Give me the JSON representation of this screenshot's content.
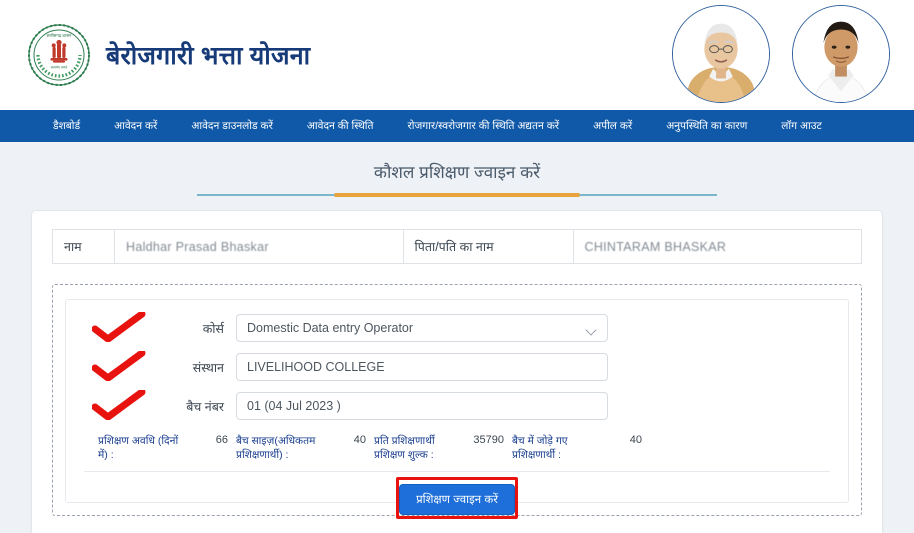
{
  "header": {
    "brand_title": "बेरोजगारी भत्ता योजना",
    "emblem_name": "chhattisgarh-government-emblem",
    "portrait_left_name": "chief-minister-portrait",
    "portrait_right_name": "minister-portrait"
  },
  "nav": {
    "items": [
      {
        "label": "डैशबोर्ड"
      },
      {
        "label": "आवेदन करें"
      },
      {
        "label": "आवेदन डाउनलोड करें"
      },
      {
        "label": "आवेदन की स्थिति"
      },
      {
        "label": "रोजगार/स्वरोजगार की स्थिति अद्यतन करें"
      },
      {
        "label": "अपील करें"
      },
      {
        "label": "अनुपस्थिति का कारण"
      },
      {
        "label": "लॉग आउट"
      }
    ]
  },
  "page": {
    "title": "कौशल प्रशिक्षण ज्वाइन करें"
  },
  "applicant": {
    "name_label": "नाम",
    "name_value": "Haldhar Prasad Bhaskar",
    "father_label": "पिता/पति का नाम",
    "father_value": "CHINTARAM BHASKAR"
  },
  "form": {
    "course_label": "कोर्स",
    "course_value": "Domestic Data entry Operator",
    "institute_label": "संस्थान",
    "institute_value": "LIVELIHOOD COLLEGE",
    "batch_label": "बैच नंबर",
    "batch_value": "01 (04 Jul 2023 )"
  },
  "stats": [
    {
      "label": "प्रशिक्षण अवधि (दिनों में) :",
      "value": "66"
    },
    {
      "label": "बैच साइज़(अधिकतम प्रशिक्षणार्थी) :",
      "value": "40"
    },
    {
      "label": "प्रति प्रशिक्षणार्थी प्रशिक्षण शुल्क :",
      "value": "35790"
    },
    {
      "label": "बैच में जोड़े गए प्रशिक्षणार्थी :",
      "value": "40"
    }
  ],
  "action": {
    "join_label": "प्रशिक्षण ज्वाइन करें"
  },
  "colors": {
    "nav_blue": "#1059a8",
    "brand_navy": "#173a78",
    "accent_orange": "#e8a33d",
    "rule_teal": "#7ab7c9",
    "button_blue": "#1e6fd9",
    "annotation_red": "#e8130f",
    "page_bg": "#eef1f5"
  }
}
